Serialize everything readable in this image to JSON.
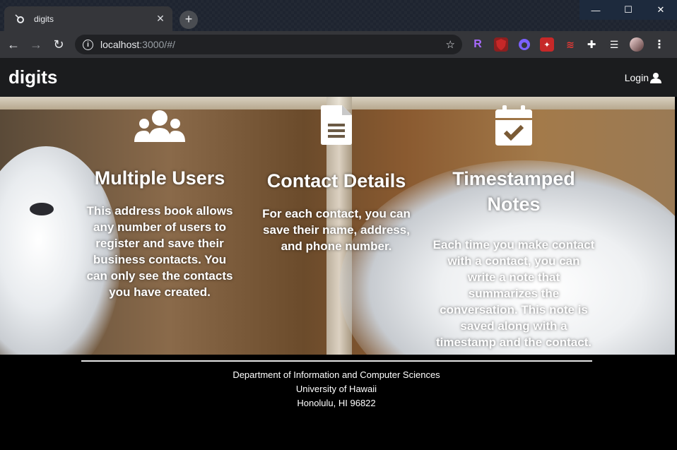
{
  "browser": {
    "tab_title": "digits",
    "new_tab": "+",
    "url_host": "localhost",
    "url_rest": ":3000/#/",
    "window_controls": [
      "—",
      "☐",
      "✕"
    ]
  },
  "navbar": {
    "brand": "digits",
    "login_label": "Login"
  },
  "features": [
    {
      "icon": "users-icon",
      "title": "Multiple Users",
      "text": "This address book allows any number of users to register and save their business contacts. You can only see the contacts you have created."
    },
    {
      "icon": "file-text-icon",
      "title": "Contact Details",
      "text": "For each contact, you can save their name, address, and phone number."
    },
    {
      "icon": "calendar-check-icon",
      "title": "Timestamped Notes",
      "text": "Each time you make contact with a contact, you can write a note that summarizes the conversation. This note is saved along with a timestamp and the contact."
    }
  ],
  "footer": {
    "line1": "Department of Information and Computer Sciences",
    "line2": "University of Hawaii",
    "line3": "Honolulu, HI 96822"
  }
}
